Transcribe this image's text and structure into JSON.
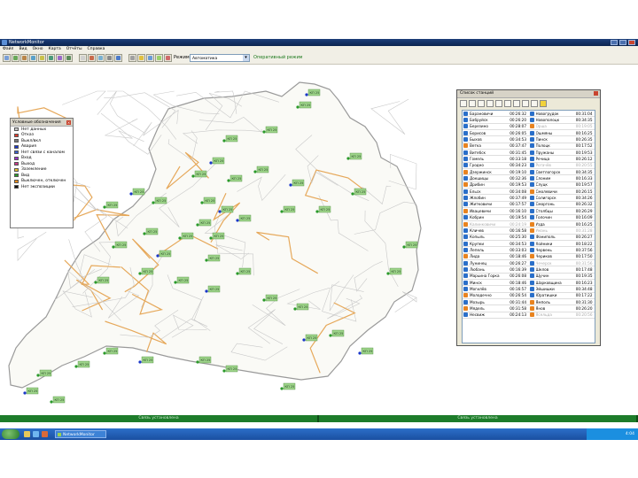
{
  "window": {
    "title": "NetworkMonitor",
    "controls": [
      "minimize",
      "maximize",
      "close"
    ]
  },
  "menu": [
    "Файл",
    "Вид",
    "Окно",
    "Карта",
    "Отчёты",
    "Справка"
  ],
  "toolbar": {
    "icons": [
      "open-icon",
      "save-icon",
      "print-icon",
      "map-icon",
      "layers-icon",
      "zoom-in-icon",
      "zoom-out-icon",
      "refresh-icon",
      "flag-icon",
      "filter-icon",
      "grid-icon",
      "tools-icon",
      "search-icon",
      "settings-icon",
      "alarm-icon",
      "list-icon",
      "chart-icon",
      "help-icon"
    ],
    "mode_label": "Режим:",
    "mode_select_value": "Автоматика",
    "mode_status": "Оперативный режим"
  },
  "legend": {
    "title": "Условные обозначения",
    "items": [
      {
        "label": "Нет данных",
        "color": "#c9c9c9"
      },
      {
        "label": "Отказ",
        "color": "#e23b2b"
      },
      {
        "label": "Выкл/вкл",
        "color": "#7a7a7a"
      },
      {
        "label": "Авария",
        "color": "#1936c9"
      },
      {
        "label": "Нет связи с каналом",
        "color": "#3a5fcd"
      },
      {
        "label": "Вход",
        "color": "#9b30c9"
      },
      {
        "label": "Выход",
        "color": "#c93a8a"
      },
      {
        "label": "Заземление",
        "color": "#e8c12a"
      },
      {
        "label": "Вид",
        "color": "#2a9a2a"
      },
      {
        "label": "Выключен, отключен",
        "color": "#f08f1f"
      },
      {
        "label": "Нет экспозиции",
        "color": "#111111"
      }
    ]
  },
  "panel": {
    "title": "Список станций",
    "left_column": [
      {
        "name": "Барановичи",
        "time": "00:26:32",
        "icon": "#2a6fc9"
      },
      {
        "name": "Бабруйск",
        "time": "00:26:20",
        "icon": "#2a6fc9"
      },
      {
        "name": "Березино",
        "time": "00:28:07",
        "icon": "#2a6fc9"
      },
      {
        "name": "Борисов",
        "time": "00:26:05",
        "icon": "#2a6fc9"
      },
      {
        "name": "Быхов",
        "time": "00:34:53",
        "icon": "#2a6fc9"
      },
      {
        "name": "Ветка",
        "time": "00:37:47",
        "icon": "#e8831f"
      },
      {
        "name": "Витебск",
        "time": "00:31:45",
        "icon": "#2a6fc9"
      },
      {
        "name": "Гомель",
        "time": "00:33:18",
        "icon": "#2a6fc9"
      },
      {
        "name": "Гродно",
        "time": "00:34:23",
        "icon": "#2a6fc9"
      },
      {
        "name": "Дзержинск",
        "time": "00:19:10",
        "icon": "#e8831f"
      },
      {
        "name": "Докшицы",
        "time": "00:32:36",
        "icon": "#2a6fc9"
      },
      {
        "name": "Дрибин",
        "time": "00:19:53",
        "icon": "#e8831f"
      },
      {
        "name": "Ельск",
        "time": "00:34:08",
        "icon": "#2a6fc9"
      },
      {
        "name": "Жлобин",
        "time": "00:37:49",
        "icon": "#2a6fc9"
      },
      {
        "name": "Житковичи",
        "time": "00:17:57",
        "icon": "#2a6fc9"
      },
      {
        "name": "Ивацевичи",
        "time": "00:16:10",
        "icon": "#e8831f"
      },
      {
        "name": "Кобрин",
        "time": "00:19:54",
        "icon": "#2a6fc9"
      },
      {
        "name": "Калинковичи",
        "time": "00:24:19",
        "icon": "#e8831f",
        "dim": true
      },
      {
        "name": "Кличев",
        "time": "00:16:58",
        "icon": "#2a6fc9"
      },
      {
        "name": "Копыль",
        "time": "00:25:30",
        "icon": "#2a6fc9"
      },
      {
        "name": "Крупки",
        "time": "00:34:53",
        "icon": "#2a6fc9"
      },
      {
        "name": "Лепель",
        "time": "00:33:03",
        "icon": "#2a6fc9"
      },
      {
        "name": "Лида",
        "time": "00:18:46",
        "icon": "#e8831f"
      },
      {
        "name": "Лунинец",
        "time": "00:26:27",
        "icon": "#2a6fc9"
      },
      {
        "name": "Любань",
        "time": "00:16:39",
        "icon": "#2a6fc9"
      },
      {
        "name": "Марьина Горка",
        "time": "00:26:08",
        "icon": "#2a6fc9"
      },
      {
        "name": "Минск",
        "time": "00:18:46",
        "icon": "#2a6fc9"
      },
      {
        "name": "Могилёв",
        "time": "00:16:57",
        "icon": "#2a6fc9"
      },
      {
        "name": "Молодечно",
        "time": "00:26:54",
        "icon": "#e8831f"
      },
      {
        "name": "Мозырь",
        "time": "00:31:44",
        "icon": "#2a6fc9"
      },
      {
        "name": "Мядель",
        "time": "00:31:58",
        "icon": "#e8831f"
      },
      {
        "name": "Несвиж",
        "time": "00:24:13",
        "icon": "#2a6fc9"
      }
    ],
    "right_column": [
      {
        "name": "Новогрудок",
        "time": "00:31:04",
        "icon": "#2a6fc9"
      },
      {
        "name": "Новополоцк",
        "time": "00:34:35",
        "icon": "#2a6fc9"
      },
      {
        "name": "Орша",
        "time": "00:19:05",
        "icon": "#e8831f",
        "dim": true
      },
      {
        "name": "Ошмяны",
        "time": "00:16:25",
        "icon": "#2a6fc9"
      },
      {
        "name": "Пинск",
        "time": "00:26:35",
        "icon": "#2a6fc9"
      },
      {
        "name": "Полоцк",
        "time": "00:17:52",
        "icon": "#2a6fc9"
      },
      {
        "name": "Пружаны",
        "time": "00:19:53",
        "icon": "#2a6fc9"
      },
      {
        "name": "Речица",
        "time": "00:26:12",
        "icon": "#2a6fc9"
      },
      {
        "name": "Рогачёв",
        "time": "00:20:55",
        "icon": "#2a6fc9",
        "dim": true
      },
      {
        "name": "Светлогорск",
        "time": "00:34:35",
        "icon": "#2a6fc9"
      },
      {
        "name": "Слоним",
        "time": "00:16:33",
        "icon": "#2a6fc9"
      },
      {
        "name": "Слуцк",
        "time": "00:19:57",
        "icon": "#2a6fc9"
      },
      {
        "name": "Смолевичи",
        "time": "00:26:15",
        "icon": "#e8831f"
      },
      {
        "name": "Солигорск",
        "time": "00:34:26",
        "icon": "#2a6fc9"
      },
      {
        "name": "Сморгонь",
        "time": "00:26:32",
        "icon": "#2a6fc9"
      },
      {
        "name": "Столбцы",
        "time": "00:26:29",
        "icon": "#2a6fc9"
      },
      {
        "name": "Толочин",
        "time": "00:16:09",
        "icon": "#2a6fc9"
      },
      {
        "name": "Узда",
        "time": "00:16:25",
        "icon": "#e8831f"
      },
      {
        "name": "Умань",
        "time": "00:31:28",
        "icon": "#e8831f",
        "dim": true
      },
      {
        "name": "Фаниполь",
        "time": "00:26:27",
        "icon": "#2a6fc9"
      },
      {
        "name": "Хойники",
        "time": "00:18:22",
        "icon": "#2a6fc9"
      },
      {
        "name": "Червень",
        "time": "00:37:56",
        "icon": "#2a6fc9"
      },
      {
        "name": "Чериков",
        "time": "00:17:50",
        "icon": "#e8831f"
      },
      {
        "name": "Чечерск",
        "time": "00:31:56",
        "icon": "#2a6fc9",
        "dim": true
      },
      {
        "name": "Шклов",
        "time": "00:17:48",
        "icon": "#2a6fc9"
      },
      {
        "name": "Щучин",
        "time": "00:19:35",
        "icon": "#2a6fc9"
      },
      {
        "name": "Шарковщина",
        "time": "00:16:23",
        "icon": "#2a6fc9"
      },
      {
        "name": "Эйшишки",
        "time": "00:34:48",
        "icon": "#2a6fc9"
      },
      {
        "name": "Юратишки",
        "time": "00:17:22",
        "icon": "#2a6fc9"
      },
      {
        "name": "Ямполь",
        "time": "00:31:30",
        "icon": "#e8831f"
      },
      {
        "name": "Янов",
        "time": "00:26:20",
        "icon": "#e8831f"
      },
      {
        "name": "Ясельда",
        "time": "00:20:56",
        "icon": "#e8831f",
        "dim": true
      }
    ]
  },
  "status_bar": [
    "Связь установлена",
    "Связь установлена"
  ],
  "taskbar": {
    "task_label": "NetworkMonitor",
    "tray_time": "4:04"
  },
  "map": {
    "station_label": "КП 25",
    "colors": {
      "fill": "#fafaf6",
      "border": "#9a9a9a",
      "station": "#9ed48a",
      "road_main": "#e6a85a",
      "road_minor": "#c9c9c9"
    }
  }
}
